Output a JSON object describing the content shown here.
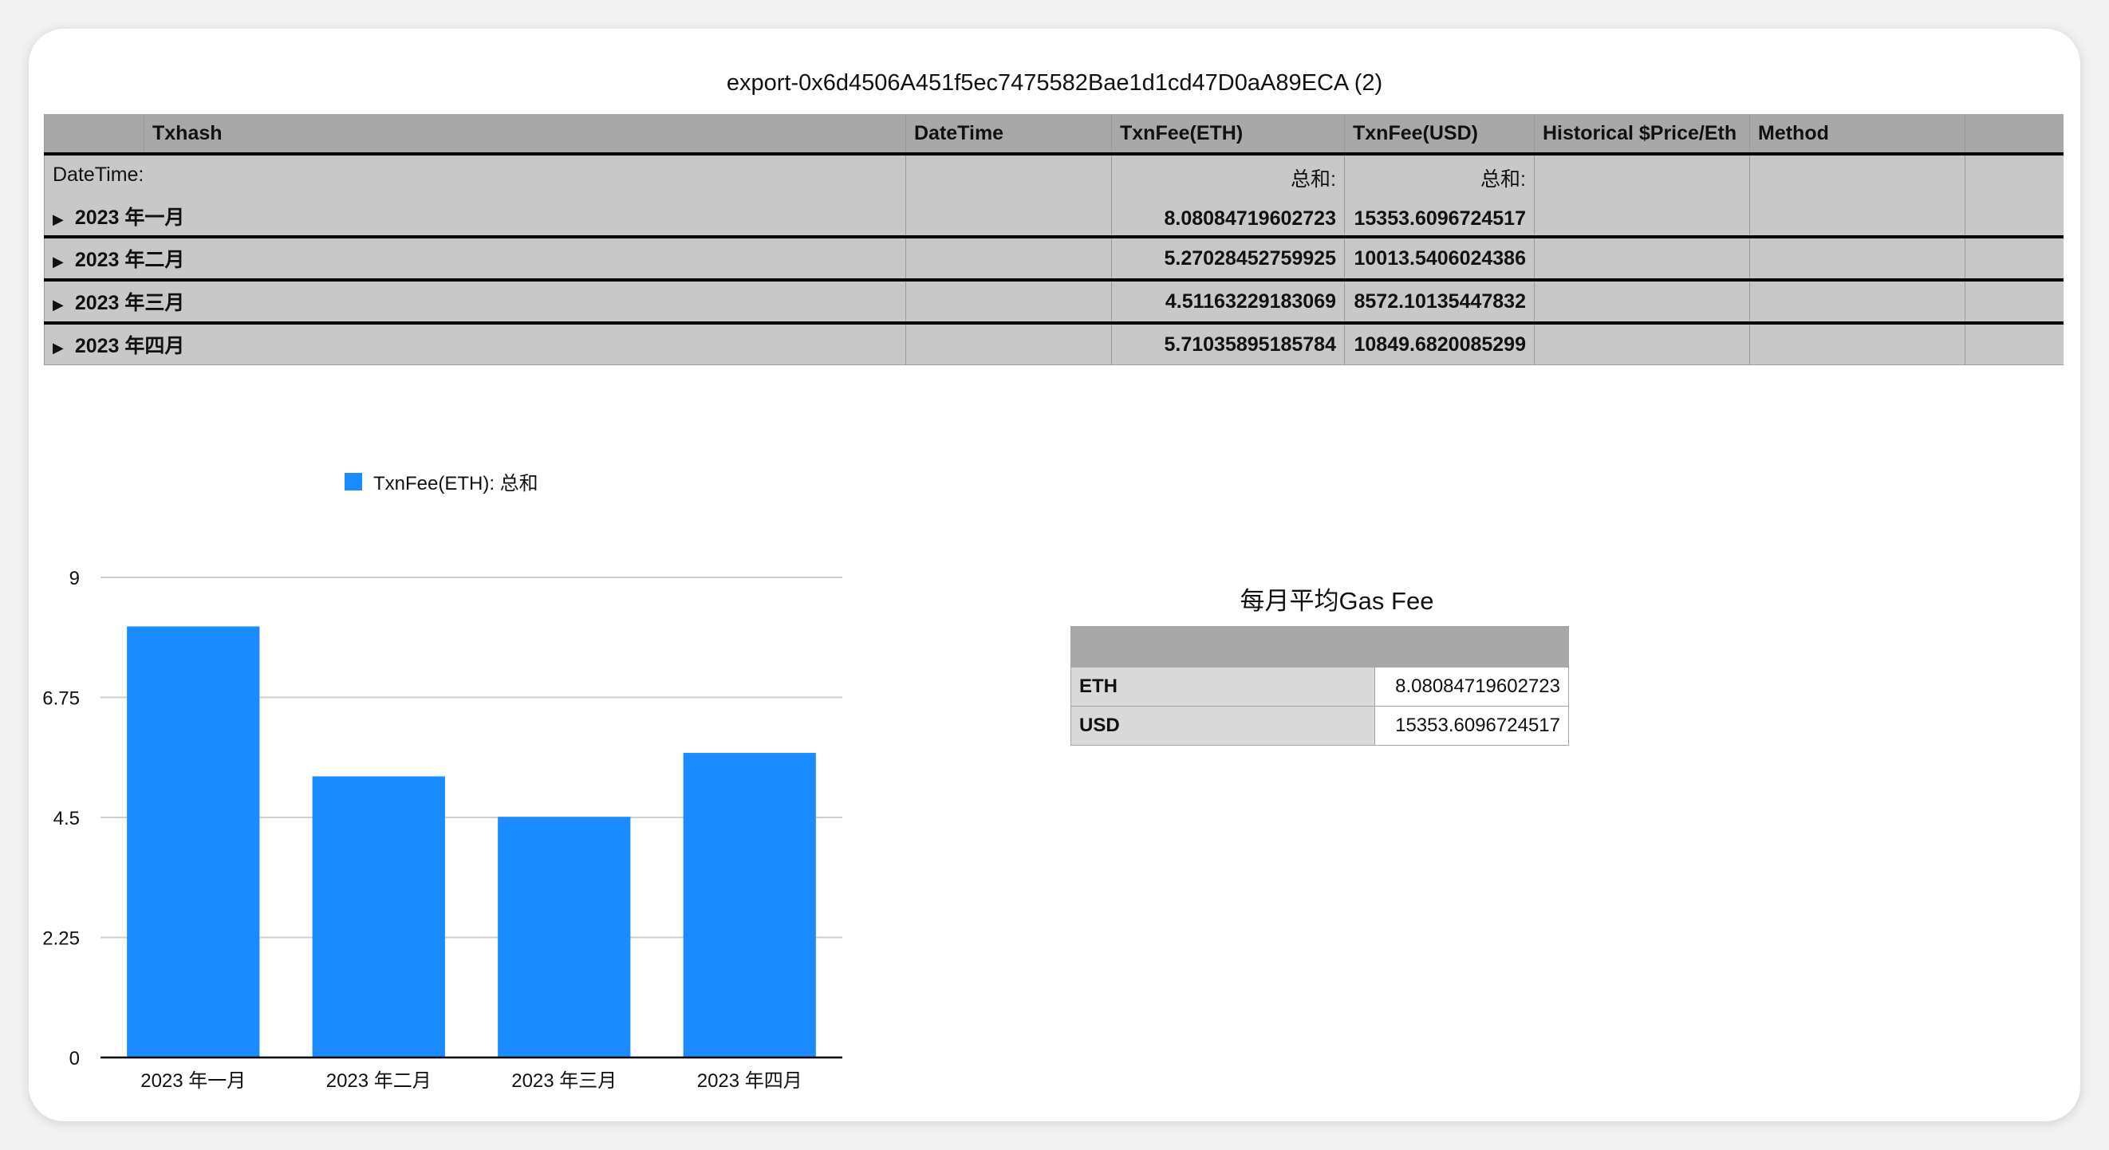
{
  "window": {
    "title": "export-0x6d4506A451f5ec7475582Bae1d1cd47D0aA89ECA (2)"
  },
  "pivot": {
    "headers": [
      "",
      "Txhash",
      "DateTime",
      "TxnFee(ETH)",
      "TxnFee(USD)",
      "Historical $Price/Eth",
      "Method",
      ""
    ],
    "row_field_label": "DateTime:",
    "sum_label_eth": "总和:",
    "sum_label_usd": "总和:",
    "expand_glyph": "▶",
    "rows": [
      {
        "label": "2023 年一月",
        "eth": "8.08084719602723",
        "usd": "15353.6096724517"
      },
      {
        "label": "2023 年二月",
        "eth": "5.27028452759925",
        "usd": "10013.5406024386"
      },
      {
        "label": "2023 年三月",
        "eth": "4.51163229183069",
        "usd": "8572.10135447832"
      },
      {
        "label": "2023 年四月",
        "eth": "5.71035895185784",
        "usd": "10849.6820085299"
      }
    ]
  },
  "chart_data": {
    "type": "bar",
    "categories": [
      "2023 年一月",
      "2023 年二月",
      "2023 年三月",
      "2023 年四月"
    ],
    "series": [
      {
        "name": "TxnFee(ETH): 总和",
        "values": [
          8.08084719602723,
          5.27028452759925,
          4.51163229183069,
          5.71035895185784
        ]
      }
    ],
    "ylim": [
      0,
      9
    ],
    "yticks": [
      "0",
      "2.25",
      "4.5",
      "6.75",
      "9"
    ],
    "grid": true,
    "legend_position": "top",
    "bar_color": "#1a8cff"
  },
  "summary": {
    "title": "每月平均Gas Fee",
    "rows": [
      {
        "key": "ETH",
        "value": "8.08084719602723"
      },
      {
        "key": "USD",
        "value": "15353.6096724517"
      }
    ]
  }
}
